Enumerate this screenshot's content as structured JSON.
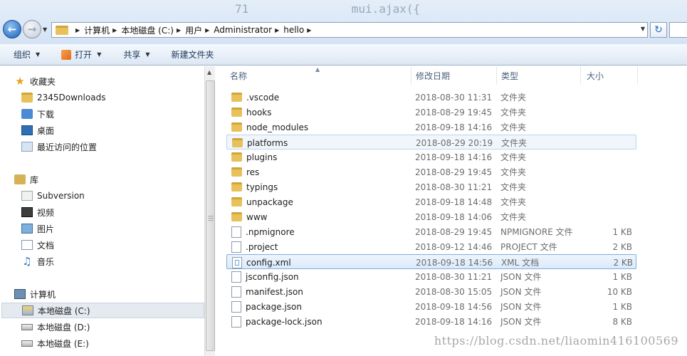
{
  "background_code": "mui.ajax({",
  "background_code_number": "71",
  "address_bar": {
    "crumbs": [
      "计算机",
      "本地磁盘 (C:)",
      "用户",
      "Administrator",
      "hello"
    ]
  },
  "toolbar": {
    "organize": "组织",
    "open": "打开",
    "share": "共享",
    "new_folder": "新建文件夹"
  },
  "nav": {
    "favorites": "收藏夹",
    "fav_items": [
      "2345Downloads",
      "下载",
      "桌面",
      "最近访问的位置"
    ],
    "libraries": "库",
    "lib_items": [
      "Subversion",
      "视频",
      "图片",
      "文档",
      "音乐"
    ],
    "computer": "计算机",
    "drives": [
      "本地磁盘 (C:)",
      "本地磁盘 (D:)",
      "本地磁盘 (E:)"
    ]
  },
  "columns": {
    "name": "名称",
    "date": "修改日期",
    "type": "类型",
    "size": "大小"
  },
  "files": [
    {
      "name": ".vscode",
      "date": "2018-08-30 11:31",
      "type": "文件夹",
      "size": "",
      "kind": "folder"
    },
    {
      "name": "hooks",
      "date": "2018-08-29 19:45",
      "type": "文件夹",
      "size": "",
      "kind": "folder"
    },
    {
      "name": "node_modules",
      "date": "2018-09-18 14:16",
      "type": "文件夹",
      "size": "",
      "kind": "folder"
    },
    {
      "name": "platforms",
      "date": "2018-08-29 20:19",
      "type": "文件夹",
      "size": "",
      "kind": "folder"
    },
    {
      "name": "plugins",
      "date": "2018-09-18 14:16",
      "type": "文件夹",
      "size": "",
      "kind": "folder"
    },
    {
      "name": "res",
      "date": "2018-08-29 19:45",
      "type": "文件夹",
      "size": "",
      "kind": "folder"
    },
    {
      "name": "typings",
      "date": "2018-08-30 11:21",
      "type": "文件夹",
      "size": "",
      "kind": "folder"
    },
    {
      "name": "unpackage",
      "date": "2018-09-18 14:48",
      "type": "文件夹",
      "size": "",
      "kind": "folder"
    },
    {
      "name": "www",
      "date": "2018-09-18 14:06",
      "type": "文件夹",
      "size": "",
      "kind": "folder"
    },
    {
      "name": ".npmignore",
      "date": "2018-08-29 19:45",
      "type": "NPMIGNORE 文件",
      "size": "1 KB",
      "kind": "file"
    },
    {
      "name": ".project",
      "date": "2018-09-12 14:46",
      "type": "PROJECT 文件",
      "size": "2 KB",
      "kind": "file"
    },
    {
      "name": "config.xml",
      "date": "2018-09-18 14:56",
      "type": "XML 文档",
      "size": "2 KB",
      "kind": "xml"
    },
    {
      "name": "jsconfig.json",
      "date": "2018-08-30 11:21",
      "type": "JSON 文件",
      "size": "1 KB",
      "kind": "file"
    },
    {
      "name": "manifest.json",
      "date": "2018-08-30 15:05",
      "type": "JSON 文件",
      "size": "10 KB",
      "kind": "file"
    },
    {
      "name": "package.json",
      "date": "2018-09-18 14:56",
      "type": "JSON 文件",
      "size": "1 KB",
      "kind": "file"
    },
    {
      "name": "package-lock.json",
      "date": "2018-09-18 14:16",
      "type": "JSON 文件",
      "size": "8 KB",
      "kind": "file"
    }
  ],
  "watermark": "https://blog.csdn.net/liaomin416100569"
}
